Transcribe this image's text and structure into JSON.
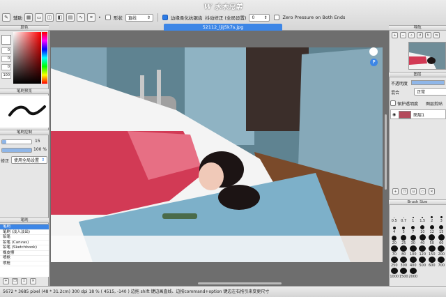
{
  "toolbar": {
    "assist_label": "辅助",
    "shape_label": "形状",
    "shape_value": "直线",
    "edge_aa_label": "边缘柔化抗锯齿",
    "stabilizer_label": "抖动修正 (全局设置)",
    "stabilizer_value": "0",
    "zero_pressure_label": "Zero Pressure on Both Ends"
  },
  "logo": {
    "text": "W 水木兄弟"
  },
  "document": {
    "tab_title": "52112_ljiJ5k7s.jpg"
  },
  "left_panel": {
    "color_title": "颜色",
    "color_values": [
      "0",
      "0",
      "0",
      "100"
    ],
    "brush_preview_title": "笔刷预览",
    "brush_control_title": "笔刷控制",
    "brush_size_value": "15",
    "brush_opacity_value": "100 %",
    "brush_opacity_fraction": 1.0,
    "brush_size_fraction": 0.15,
    "correction_label": "修正",
    "global_setting_label": "使用全局设置",
    "brush_list_title": "笔刷",
    "brush_list": [
      "笔刷",
      "笔刷 (淡入淡出)",
      "铅笔",
      "铅笔 (Canvas)",
      "铅笔 (Sketchbook)",
      "橡皮擦",
      "喷枪",
      "喷枪"
    ],
    "selected_brush_index": 0
  },
  "right_panel": {
    "navigator_title": "导航",
    "layers_title": "图层",
    "opacity_label": "不透明度",
    "blend_label": "混合",
    "blend_value": "正常",
    "protect_alpha_label": "保护透明度",
    "clipping_label": "图层剪贴",
    "layer_name": "图层1",
    "brush_size_title": "Brush Size",
    "brush_sizes": [
      "0.5",
      "0.7",
      "1",
      "1.5",
      "2",
      "3",
      "4",
      "5",
      "7",
      "10",
      "12",
      "15",
      "20",
      "25",
      "30",
      "40",
      "50",
      "60",
      "70",
      "80",
      "100",
      "120",
      "150",
      "200",
      "250",
      "300",
      "400",
      "500",
      "600",
      "700",
      "1000",
      "1500",
      "2000"
    ]
  },
  "status_bar": {
    "text": "5672 * 3685 pixel  (48 * 31.2cm)  300 dpi  18 %  ( 4515, -140 )  边拖 shift 键边画直线、边按command+option 键边左右拖引来变更尺寸"
  },
  "colors": {
    "accent": "#3d86e6",
    "canvas_bg": "#6e6e6e"
  }
}
